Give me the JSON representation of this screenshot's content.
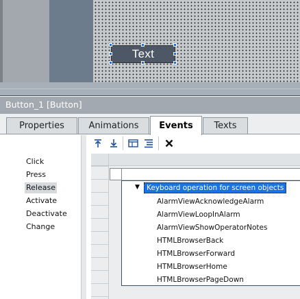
{
  "canvas": {
    "button_text": "Text"
  },
  "inspector": {
    "title": "Button_1 [Button]"
  },
  "tabs": [
    {
      "label": "Properties",
      "active": false
    },
    {
      "label": "Animations",
      "active": false
    },
    {
      "label": "Events",
      "active": true
    },
    {
      "label": "Texts",
      "active": false
    }
  ],
  "events": [
    {
      "label": "Click",
      "selected": false
    },
    {
      "label": "Press",
      "selected": false
    },
    {
      "label": "Release",
      "selected": true
    },
    {
      "label": "Activate",
      "selected": false
    },
    {
      "label": "Deactivate",
      "selected": false
    },
    {
      "label": "Change",
      "selected": false
    }
  ],
  "toolbar": {
    "icons": [
      "move-up-icon",
      "move-down-icon",
      "script-icon",
      "list-icon",
      "delete-icon"
    ]
  },
  "function_list": {
    "group_label": "Keyboard operation for screen objects",
    "items": [
      "AlarmViewAcknowledgeAlarm",
      "AlarmViewLoopInAlarm",
      "AlarmViewShowOperatorNotes",
      "HTMLBrowserBack",
      "HTMLBrowserForward",
      "HTMLBrowserHome",
      "HTMLBrowserPageDown"
    ]
  },
  "colors": {
    "selection": "#1a73e0",
    "canvas_button": "#4e5766",
    "title_bar": "#a2a9b0"
  }
}
